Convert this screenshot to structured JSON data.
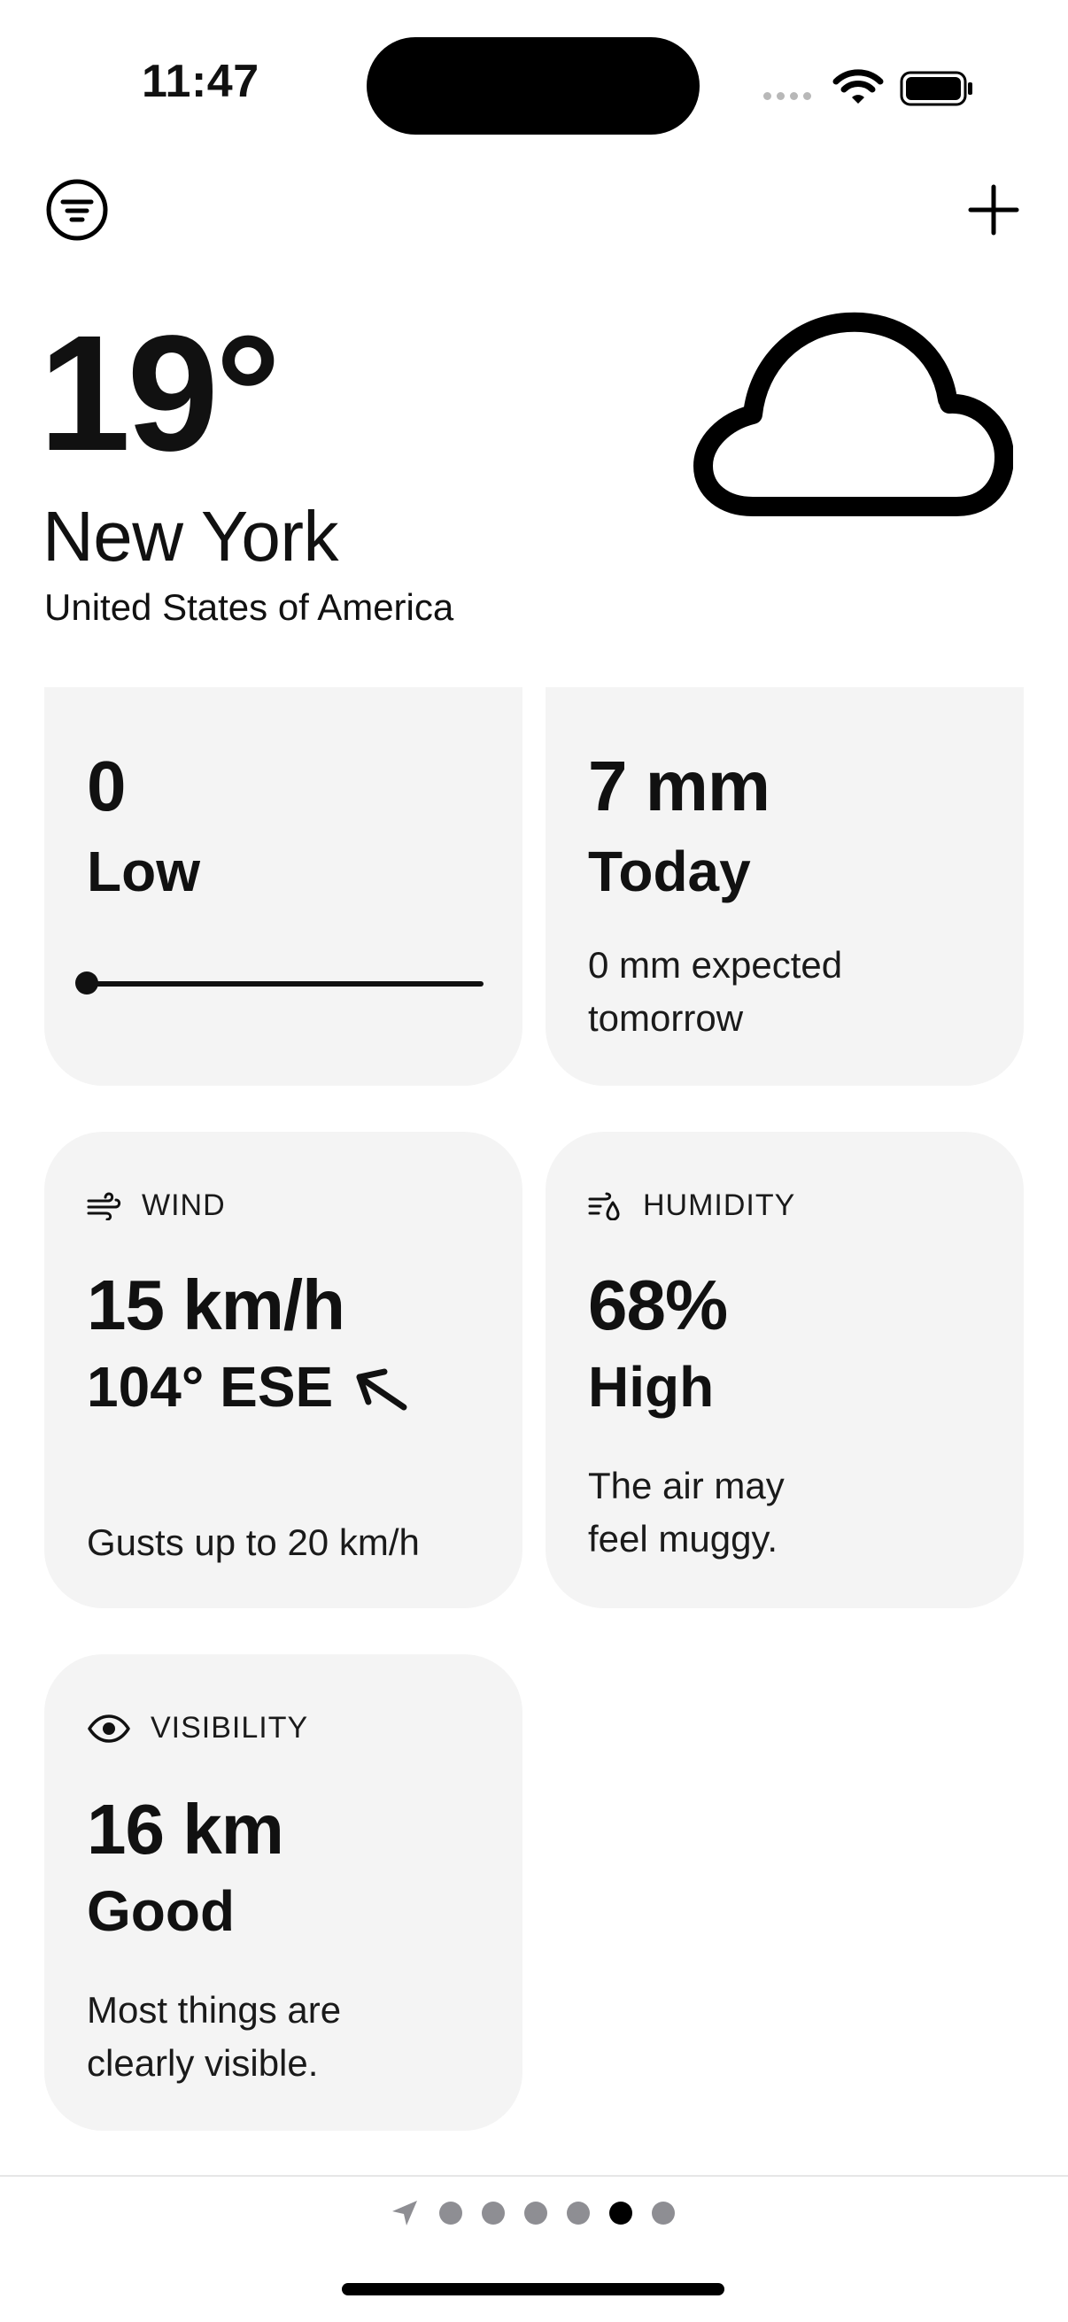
{
  "status_bar": {
    "time": "11:47"
  },
  "header": {
    "temperature": "19°",
    "city": "New York",
    "country": "United States of America",
    "condition_icon": "cloud-icon"
  },
  "cards": {
    "uv": {
      "value": "0",
      "level": "Low",
      "scale_fraction": 0
    },
    "precipitation": {
      "value": "7 mm",
      "period": "Today",
      "note": "0 mm expected tomorrow"
    },
    "wind": {
      "label": "WIND",
      "speed": "15 km/h",
      "direction": "104° ESE",
      "gusts": "Gusts up to 20 km/h"
    },
    "humidity": {
      "label": "HUMIDITY",
      "value": "68%",
      "level": "High",
      "note": "The air may feel muggy."
    },
    "visibility": {
      "label": "VISIBILITY",
      "value": "16 km",
      "level": "Good",
      "note": "Most things are clearly visible."
    }
  },
  "pager": {
    "page_count": 6,
    "active_index": 4
  },
  "colors": {
    "background": "#ffffff",
    "card": "#f4f4f4",
    "text": "#111111",
    "inactive_dot": "#8e8e93"
  }
}
